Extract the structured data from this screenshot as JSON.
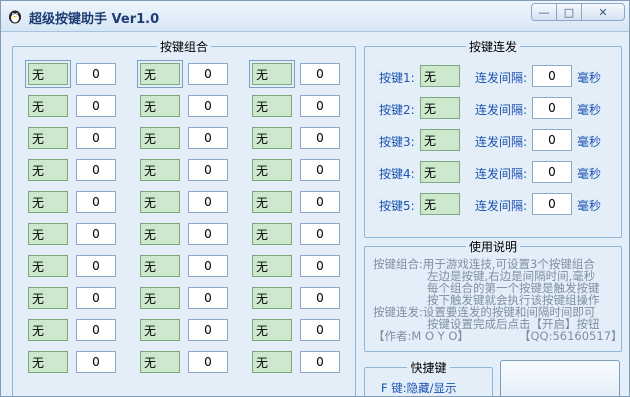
{
  "window": {
    "title": "超级按键助手 Ver1.0",
    "min_glyph": "—",
    "max_glyph": "□",
    "close_glyph": "✕"
  },
  "combo": {
    "legend": "按键组合",
    "rows": [
      [
        {
          "key": "无",
          "interval": "0"
        },
        {
          "key": "无",
          "interval": "0"
        },
        {
          "key": "无",
          "interval": "0"
        }
      ],
      [
        {
          "key": "无",
          "interval": "0"
        },
        {
          "key": "无",
          "interval": "0"
        },
        {
          "key": "无",
          "interval": "0"
        }
      ],
      [
        {
          "key": "无",
          "interval": "0"
        },
        {
          "key": "无",
          "interval": "0"
        },
        {
          "key": "无",
          "interval": "0"
        }
      ],
      [
        {
          "key": "无",
          "interval": "0"
        },
        {
          "key": "无",
          "interval": "0"
        },
        {
          "key": "无",
          "interval": "0"
        }
      ],
      [
        {
          "key": "无",
          "interval": "0"
        },
        {
          "key": "无",
          "interval": "0"
        },
        {
          "key": "无",
          "interval": "0"
        }
      ],
      [
        {
          "key": "无",
          "interval": "0"
        },
        {
          "key": "无",
          "interval": "0"
        },
        {
          "key": "无",
          "interval": "0"
        }
      ],
      [
        {
          "key": "无",
          "interval": "0"
        },
        {
          "key": "无",
          "interval": "0"
        },
        {
          "key": "无",
          "interval": "0"
        }
      ],
      [
        {
          "key": "无",
          "interval": "0"
        },
        {
          "key": "无",
          "interval": "0"
        },
        {
          "key": "无",
          "interval": "0"
        }
      ],
      [
        {
          "key": "无",
          "interval": "0"
        },
        {
          "key": "无",
          "interval": "0"
        },
        {
          "key": "无",
          "interval": "0"
        }
      ],
      [
        {
          "key": "无",
          "interval": "0"
        },
        {
          "key": "无",
          "interval": "0"
        },
        {
          "key": "无",
          "interval": "0"
        }
      ]
    ]
  },
  "repeat": {
    "legend": "按键连发",
    "rows": [
      {
        "label": "按键1:",
        "key": "无",
        "interval_label": "连发间隔:",
        "interval": "0",
        "unit": "毫秒"
      },
      {
        "label": "按键2:",
        "key": "无",
        "interval_label": "连发间隔:",
        "interval": "0",
        "unit": "毫秒"
      },
      {
        "label": "按键3:",
        "key": "无",
        "interval_label": "连发间隔:",
        "interval": "0",
        "unit": "毫秒"
      },
      {
        "label": "按键4:",
        "key": "无",
        "interval_label": "连发间隔:",
        "interval": "0",
        "unit": "毫秒"
      },
      {
        "label": "按键5:",
        "key": "无",
        "interval_label": "连发间隔:",
        "interval": "0",
        "unit": "毫秒"
      }
    ]
  },
  "help": {
    "legend": "使用说明",
    "lines": [
      "按键组合:用于游戏连技,可设置3个按键组合",
      "左边是按键,右边是间隔时间,毫秒",
      "每个组合的第一个按键是触发按键",
      "按下触发键就会执行该按键组操作",
      "按键连发:设置要连发的按键和间隔时间即可",
      "按键设置完成后点击【开启】按钮"
    ],
    "author": "【作者:M O Y O】",
    "qq": "【QQ:56160517】"
  },
  "hotkey": {
    "legend": "快捷键",
    "text": "F 键:隐藏/显示"
  },
  "colors": {
    "label_blue": "#1b53b0",
    "key_bg": "#cde8cc",
    "border": "#8eb6da"
  }
}
